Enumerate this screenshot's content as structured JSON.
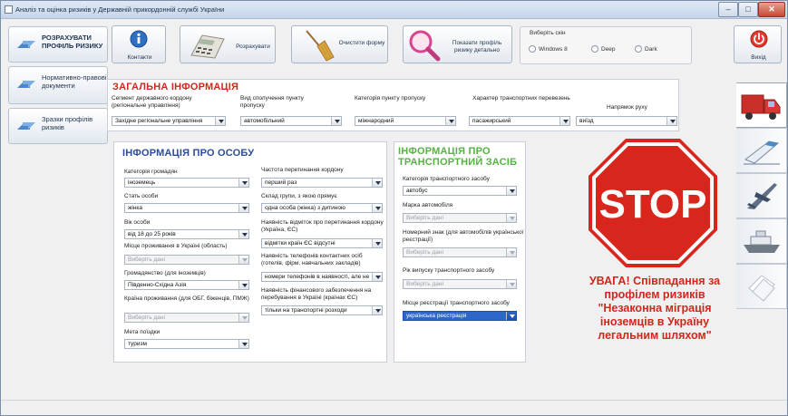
{
  "window": {
    "title": "Аналіз та оцінка ризиків у Державній прикордонній службі України",
    "min": "–",
    "max": "□",
    "close": "✕"
  },
  "left_nav": [
    {
      "label": "РОЗРАХУВАТИ ПРОФІЛЬ РИЗИКУ",
      "icon": "arrows-icon"
    },
    {
      "label": "Нормативно-правові документи",
      "icon": "arrows-icon"
    },
    {
      "label": "Зразки профілів ризиків",
      "icon": "arrows-icon"
    }
  ],
  "toolbar": {
    "contacts": "Контакти",
    "calculate": "Розрахувати",
    "clear": "Очистити форму",
    "show_profile": "Показати профіль ризику детально",
    "exit": "Вихід"
  },
  "theme": {
    "legend": "Виберіть скін",
    "options": [
      "Windows 8",
      "Deep",
      "Dark"
    ]
  },
  "general": {
    "title": "ЗАГАЛЬНА ІНФОРМАЦІЯ",
    "fields": [
      {
        "label": "Сегмент державного кордону (регіональне управління)",
        "value": "Західне регіональне управління"
      },
      {
        "label": "Вид сполучення пункту пропуску",
        "value": "автомобільний"
      },
      {
        "label": "Категорія пункту пропуску",
        "value": "міжнародний"
      },
      {
        "label": "Характер транспортних перевезень",
        "value": "пасажирський"
      },
      {
        "label": "Напрямок руху",
        "value": "виїзд"
      }
    ]
  },
  "person": {
    "title": "ІНФОРМАЦІЯ ПРО ОСОБУ",
    "left": [
      {
        "label": "Категорія громадян",
        "value": "іноземець"
      },
      {
        "label": "Стать особи",
        "value": "жінка"
      },
      {
        "label": "Вік особи",
        "value": "від 18 до 25 років"
      },
      {
        "label": "Місце проживання в Україні (область)",
        "value": "Виберіть дані"
      },
      {
        "label": "Громадянство (для іноземців)",
        "value": "Південно-Східна Азія"
      },
      {
        "label": "Країна проживання (для ОБГ, біженців, ПМЖ)",
        "value": "Виберіть дані"
      },
      {
        "label": "Мета поїздки",
        "value": "туризм"
      }
    ],
    "right": [
      {
        "label": "Частота перетинання кордону",
        "value": "перший раз"
      },
      {
        "label": "Склад групи, з якою прямує",
        "value": "одна особа (жінка) з дитиною"
      },
      {
        "label": "Наявність відміток про перетинання кордону (Україна, ЄС)",
        "value": "відмітки країн ЄС відсутні"
      },
      {
        "label": "Наявність телефонів контактних осіб (готелів, фірм, навчальних закладів)",
        "value": "номери телефонів в наявності, але не"
      },
      {
        "label": "Наявність фінансового забезпечення на перебування в Україні (країнах ЄС)",
        "value": "тільки на транспортні розходи"
      }
    ]
  },
  "transport": {
    "title": "ІНФОРМАЦІЯ ПРО ТРАНСПОРТНИЙ ЗАСІБ",
    "fields": [
      {
        "label": "Категорія транспортного засобу",
        "value": "автобус"
      },
      {
        "label": "Марка автомобіля",
        "value": "Виберіть дані"
      },
      {
        "label": "Номерний знак (для автомобілів української реєстрації)",
        "value": "Виберіть дані"
      },
      {
        "label": "Рік випуску транспортного засобу",
        "value": "Виберіть дані"
      },
      {
        "label": "Місце реєстрації транспортного засобу",
        "value": "українська реєстрація"
      }
    ]
  },
  "stop_sign": "STOP",
  "warning": "УВАГА! Співпадання за профілем ризиків \"Незаконна міграція іноземців в Україну легальним шляхом\"",
  "colors": {
    "title_red": "#d0271d",
    "title_blue": "#2a4c9c",
    "title_green": "#56b244",
    "stop": "#d8261d"
  },
  "side_tabs": [
    "truck-icon",
    "train-icon",
    "airplane-icon",
    "ship-icon",
    "papers-icon"
  ]
}
